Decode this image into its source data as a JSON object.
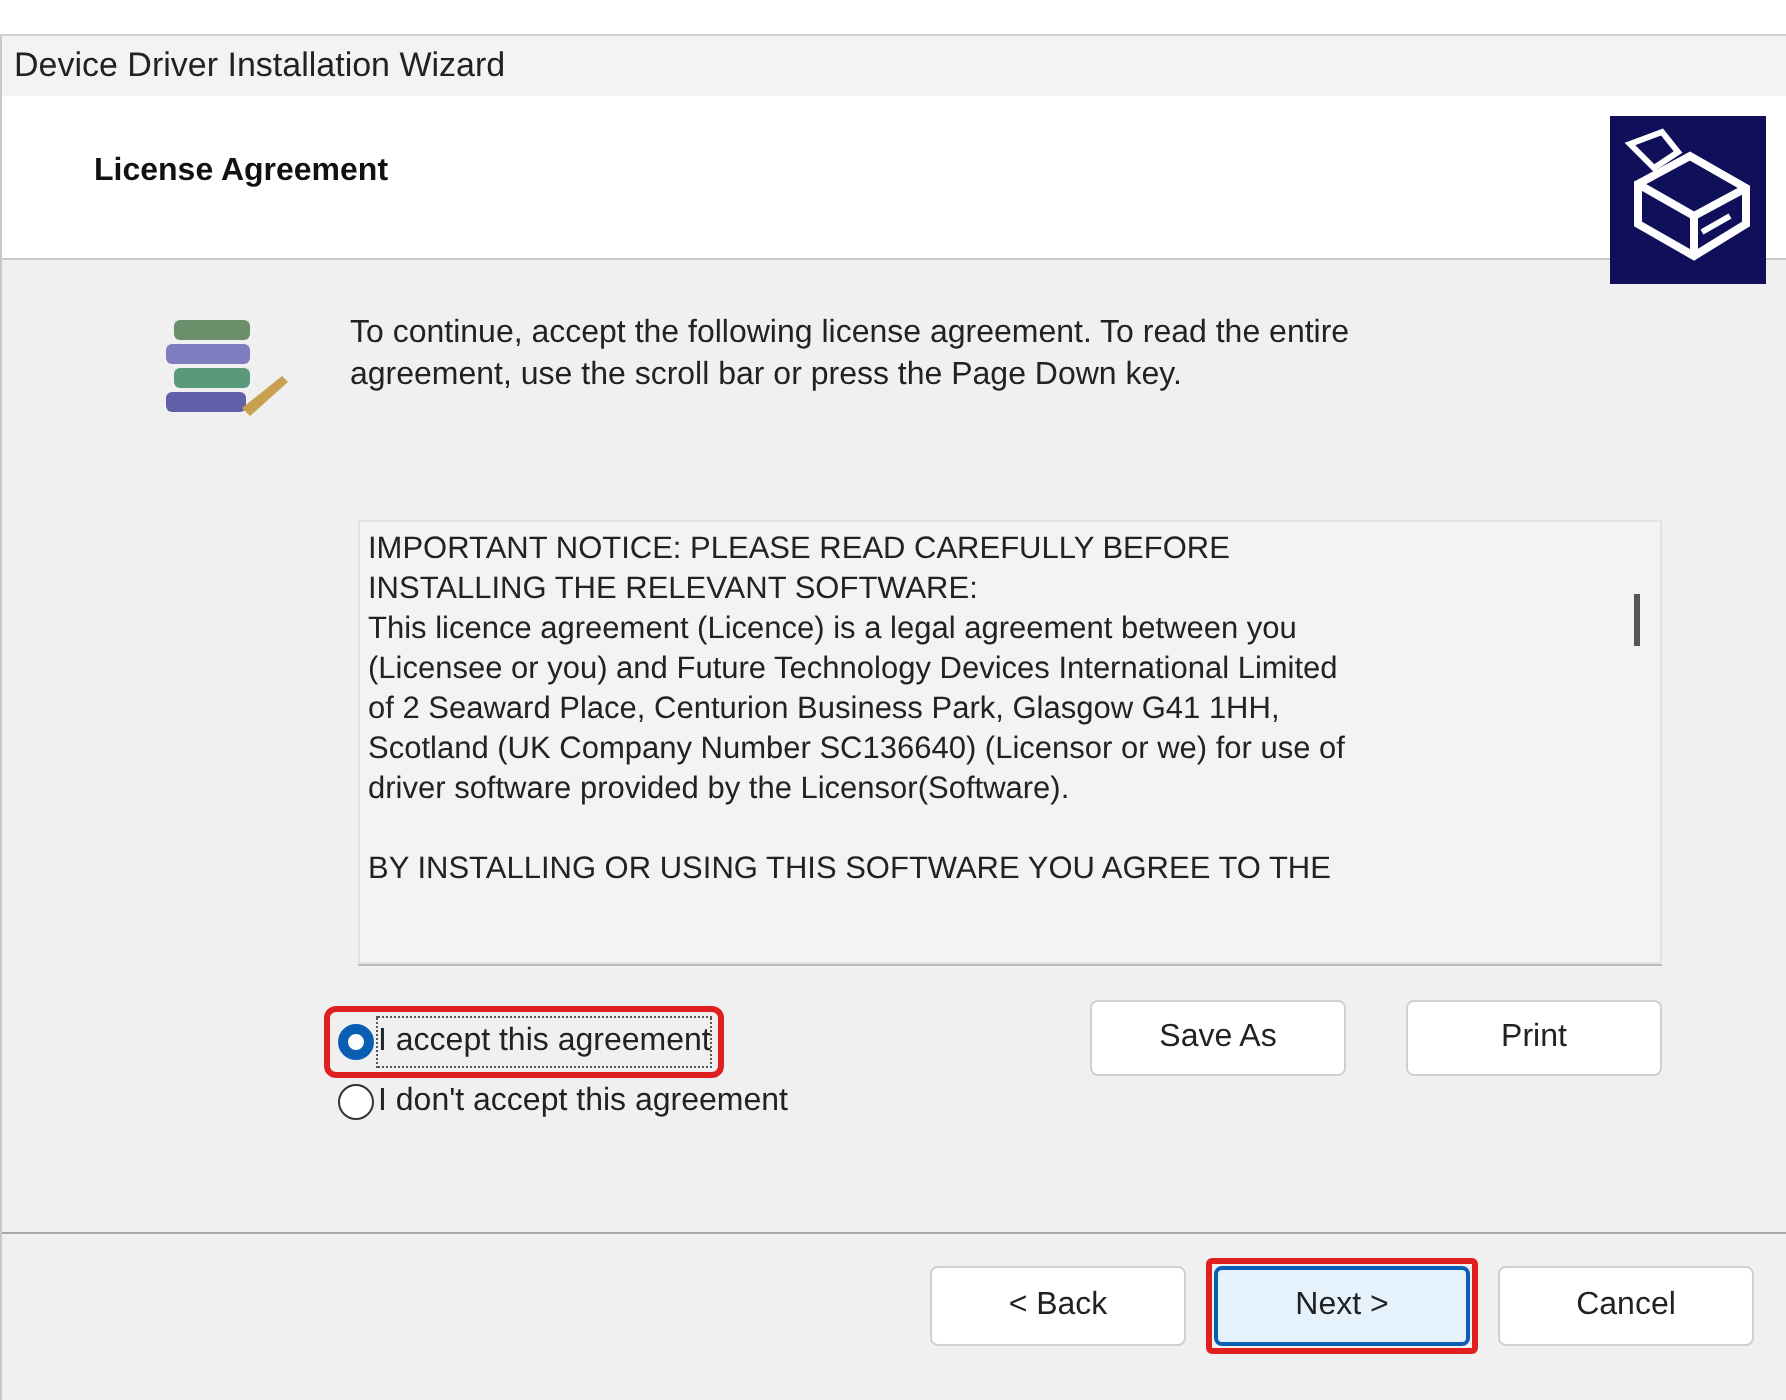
{
  "window": {
    "title": "Device Driver Installation Wizard"
  },
  "header": {
    "title": "License Agreement"
  },
  "instruction": [
    "To continue, accept the following license agreement. To read the entire",
    "agreement, use the scroll bar or press the Page Down key."
  ],
  "license_text": [
    [
      "IMPORTANT NOTICE: PLEASE READ CAREFULLY BEFORE",
      "INSTALLING THE RELEVANT SOFTWARE:",
      "This licence agreement (Licence) is a legal agreement between you",
      "(Licensee or you) and Future Technology Devices International Limited",
      "of 2 Seaward Place, Centurion Business Park, Glasgow G41 1HH,",
      "Scotland (UK Company Number SC136640) (Licensor or we) for use of",
      "driver software provided by the Licensor(Software)."
    ],
    [
      "BY INSTALLING OR USING THIS SOFTWARE YOU AGREE TO THE"
    ]
  ],
  "options": [
    {
      "label": "I accept this agreement",
      "selected": true,
      "highlighted": true
    },
    {
      "label": "I don't accept this agreement",
      "selected": false,
      "highlighted": false
    }
  ],
  "side_buttons": [
    {
      "label": "Save As"
    },
    {
      "label": "Print"
    }
  ],
  "nav_buttons": [
    {
      "label": "< Back",
      "highlighted": false,
      "default": false
    },
    {
      "label": "Next >",
      "highlighted": true,
      "default": true
    },
    {
      "label": "Cancel",
      "highlighted": false,
      "default": false
    }
  ]
}
